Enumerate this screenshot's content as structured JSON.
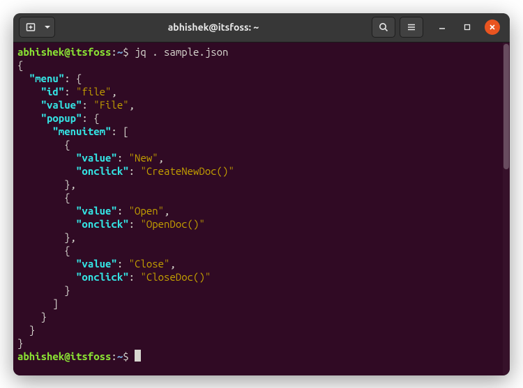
{
  "titlebar": {
    "title": "abhishek@itsfoss: ~"
  },
  "prompt": {
    "user_host": "abhishek@itsfoss",
    "colon": ":",
    "path": "~",
    "dollar": "$ ",
    "command": "jq . sample.json"
  },
  "output": {
    "l0": "{",
    "k_menu": "\"menu\"",
    "k_id": "\"id\"",
    "v_file": "\"file\"",
    "k_value": "\"value\"",
    "v_File": "\"File\"",
    "k_popup": "\"popup\"",
    "k_menuitem": "\"menuitem\"",
    "k_value2": "\"value\"",
    "v_New": "\"New\"",
    "k_onclick": "\"onclick\"",
    "v_CreateNewDoc": "\"CreateNewDoc()\"",
    "v_Open": "\"Open\"",
    "v_OpenDoc": "\"OpenDoc()\"",
    "v_Close": "\"Close\"",
    "v_CloseDoc": "\"CloseDoc()\""
  }
}
